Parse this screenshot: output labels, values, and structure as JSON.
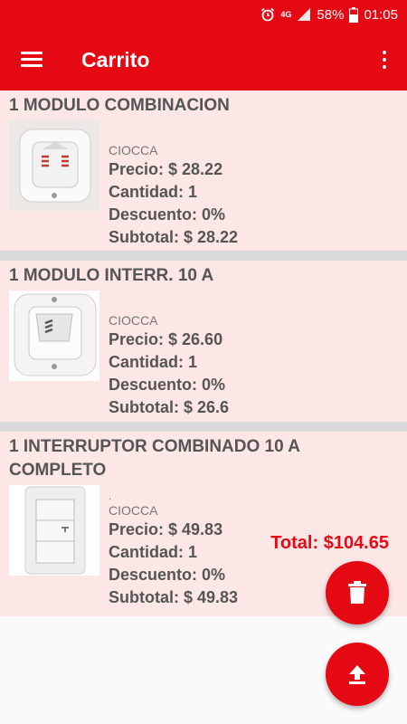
{
  "status_bar": {
    "network": "4G",
    "battery": "58%",
    "time": "01:05"
  },
  "app_bar": {
    "title": "Carrito"
  },
  "cart": {
    "items": [
      {
        "name": "1 MODULO COMBINACION",
        "brand": "CIOCCA",
        "price": "Precio: $ 28.22",
        "quantity": "Cantidad: 1",
        "discount": "Descuento: 0%",
        "subtotal": "Subtotal: $ 28.22"
      },
      {
        "name": "1 MODULO INTERR. 10 A",
        "brand": "CIOCCA",
        "price": "Precio: $ 26.60",
        "quantity": "Cantidad: 1",
        "discount": "Descuento: 0%",
        "subtotal": "Subtotal: $ 26.6"
      },
      {
        "name": "1 INTERRUPTOR COMBINADO 10 A COMPLETO",
        "description": ".",
        "brand": "CIOCCA",
        "price": "Precio: $ 49.83",
        "quantity": "Cantidad: 1",
        "discount": "Descuento: 0%",
        "subtotal": "Subtotal: $ 49.83"
      }
    ],
    "total": "Total: $104.65"
  },
  "actions": {
    "delete_icon": "trash-icon",
    "upload_icon": "upload-icon"
  },
  "colors": {
    "primary": "#e50914",
    "card_bg": "#fde6e6"
  }
}
